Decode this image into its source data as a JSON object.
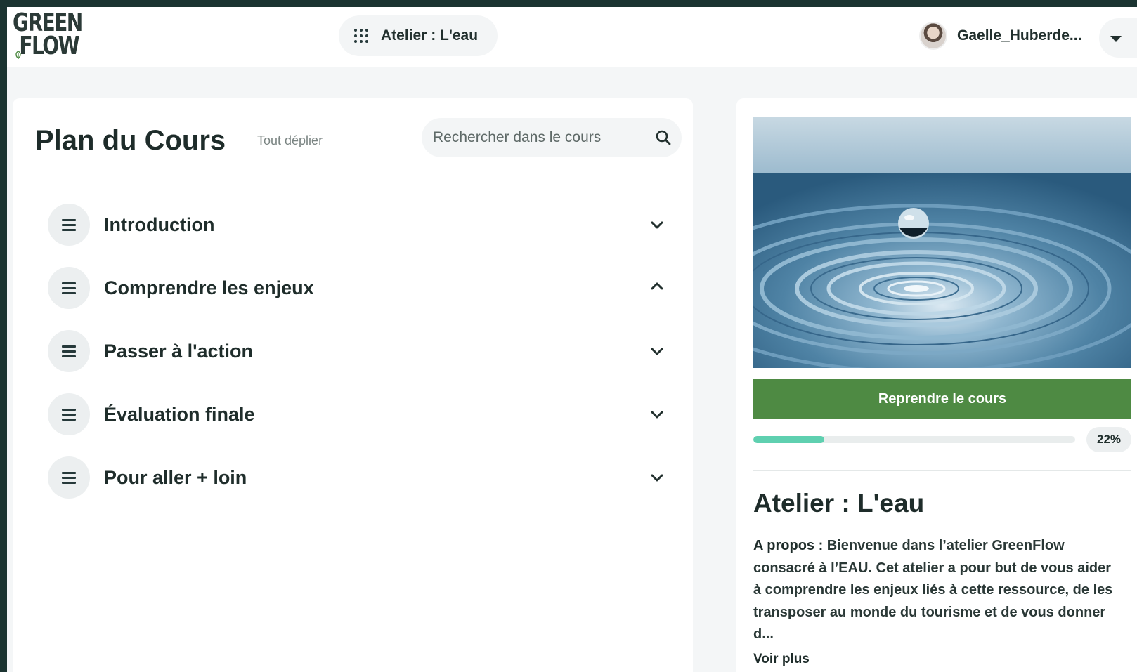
{
  "brand": {
    "logo_line1": "GREEN",
    "logo_line2": "FLOW",
    "logo_name": "green-flow-logo",
    "accent": "#4e8a43",
    "dark": "#1b3431"
  },
  "header": {
    "course_label": "Atelier : L'eau",
    "course_icon": "grid-dots-icon",
    "user_name": "Gaelle_Huberde...",
    "user_menu_icon": "caret-down-icon"
  },
  "plan": {
    "title": "Plan du Cours",
    "expand_all": "Tout déplier",
    "search_placeholder": "Rechercher dans le cours",
    "search_icon": "search-icon",
    "sections": [
      {
        "title": "Introduction",
        "expanded": false
      },
      {
        "title": "Comprendre les enjeux",
        "expanded": true
      },
      {
        "title": "Passer à l'action",
        "expanded": false
      },
      {
        "title": "Évaluation finale",
        "expanded": false
      },
      {
        "title": "Pour aller + loin",
        "expanded": false
      }
    ]
  },
  "course": {
    "image_subject": "water-droplet-ripple",
    "resume_label": "Reprendre le cours",
    "progress_percent": 22,
    "progress_label": "22%",
    "progress_color": "#5fd0b0",
    "title": "Atelier : L'eau",
    "about_lead": "A propos :",
    "about_text": " Bienvenue dans l’atelier GreenFlow consacré à l’EAU. Cet atelier a pour but de vous aider à comprendre les enjeux liés à cette ressource, de les transposer au monde du tourisme et de vous donner d...",
    "see_more": "Voir plus"
  }
}
